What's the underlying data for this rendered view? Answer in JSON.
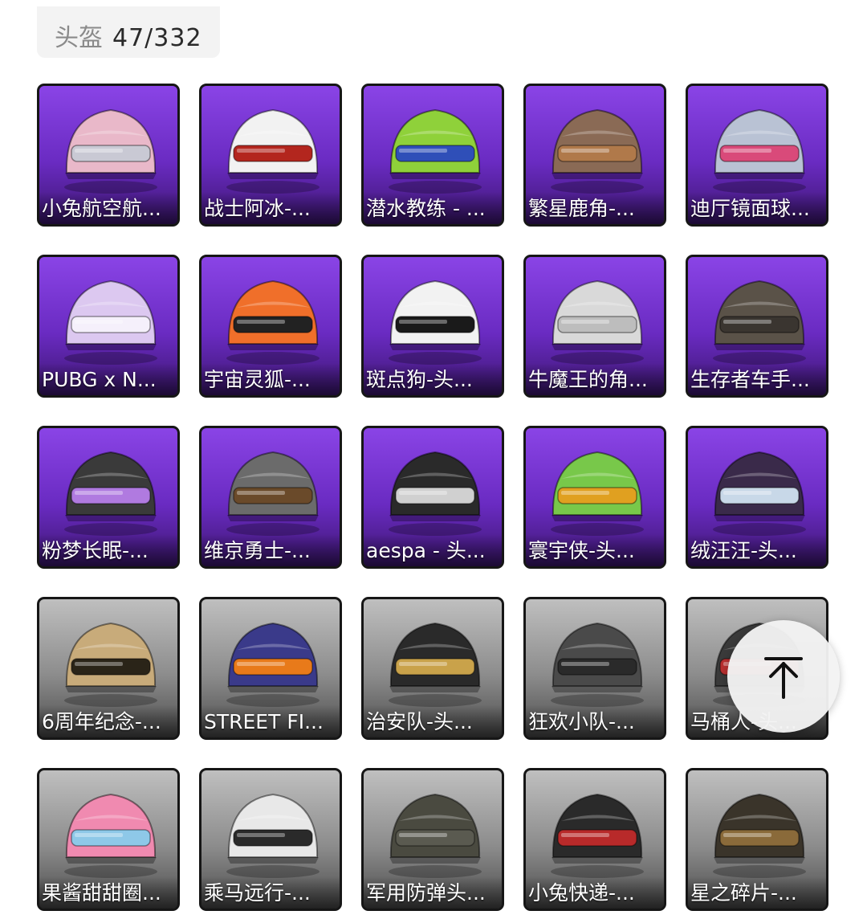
{
  "header": {
    "category": "头盔",
    "count": "47/332"
  },
  "items": [
    {
      "label": "小兔航空航...",
      "bg": "purple",
      "color": "#e9b8c9",
      "accent": "#c9c9d4"
    },
    {
      "label": "战士阿冰-...",
      "bg": "purple",
      "color": "#f2f2f2",
      "accent": "#b3261e"
    },
    {
      "label": "潜水教练 - ...",
      "bg": "purple",
      "color": "#8fd13a",
      "accent": "#2f4fb8"
    },
    {
      "label": "繁星鹿角-...",
      "bg": "purple",
      "color": "#8a6a55",
      "accent": "#b0794a"
    },
    {
      "label": "迪厅镜面球...",
      "bg": "purple",
      "color": "#b9c2d4",
      "accent": "#d94a7a"
    },
    {
      "label": "PUBG x N...",
      "bg": "purple",
      "color": "#dcc8f0",
      "accent": "#f5f0fb"
    },
    {
      "label": "宇宙灵狐-...",
      "bg": "purple",
      "color": "#f06f2a",
      "accent": "#222222"
    },
    {
      "label": "斑点狗-头...",
      "bg": "purple",
      "color": "#f2f2f2",
      "accent": "#1a1a1a"
    },
    {
      "label": "牛魔王的角...",
      "bg": "purple",
      "color": "#d9d9d9",
      "accent": "#bdbdbd"
    },
    {
      "label": "生存者车手...",
      "bg": "purple",
      "color": "#5a5248",
      "accent": "#3a3530"
    },
    {
      "label": "粉梦长眠-...",
      "bg": "purple",
      "color": "#3a3a3a",
      "accent": "#b07ae0"
    },
    {
      "label": "维京勇士-...",
      "bg": "purple",
      "color": "#6b6b6b",
      "accent": "#6a4a2a"
    },
    {
      "label": "aespa - 头...",
      "bg": "purple",
      "color": "#2a2a2a",
      "accent": "#d0d0d0"
    },
    {
      "label": "寰宇侠-头...",
      "bg": "purple",
      "color": "#78c84a",
      "accent": "#e0a020"
    },
    {
      "label": "绒汪汪-头...",
      "bg": "purple",
      "color": "#3a2a4a",
      "accent": "#c8d8e8"
    },
    {
      "label": "6周年纪念-...",
      "bg": "gray",
      "color": "#c8ab7a",
      "accent": "#2a2418"
    },
    {
      "label": "STREET FI...",
      "bg": "gray",
      "color": "#3a3a8a",
      "accent": "#e87a1a"
    },
    {
      "label": "治安队-头...",
      "bg": "gray",
      "color": "#2a2a2a",
      "accent": "#c9a24a"
    },
    {
      "label": "狂欢小队-...",
      "bg": "gray",
      "color": "#4a4a4a",
      "accent": "#2a2a2a"
    },
    {
      "label": "马桶人-头...",
      "bg": "gray",
      "color": "#3a3a3a",
      "accent": "#b83030"
    },
    {
      "label": "果酱甜甜圈...",
      "bg": "gray",
      "color": "#f08ab0",
      "accent": "#8ec8e8"
    },
    {
      "label": "乘马远行-...",
      "bg": "gray",
      "color": "#e8e8e8",
      "accent": "#2a2a2a"
    },
    {
      "label": "军用防弹头...",
      "bg": "gray",
      "color": "#4a4a40",
      "accent": "#5a5a50"
    },
    {
      "label": "小兔快递-...",
      "bg": "gray",
      "color": "#2a2a2a",
      "accent": "#b82a2a"
    },
    {
      "label": "星之碎片-...",
      "bg": "gray",
      "color": "#3a342a",
      "accent": "#8a6a3a"
    }
  ],
  "scroll_top_icon": "arrow-up-to-top-icon"
}
